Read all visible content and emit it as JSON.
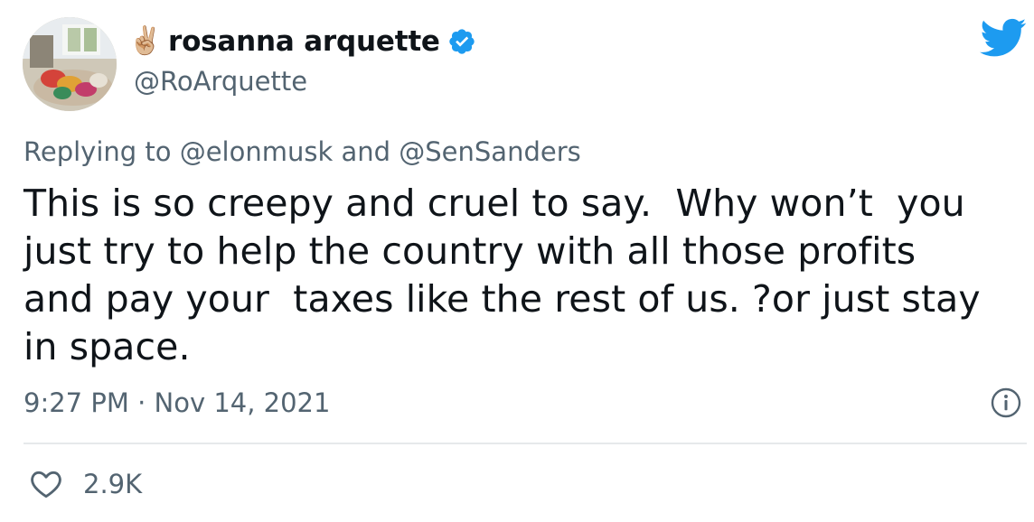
{
  "author": {
    "emoji": "✌🏼",
    "display_name": "rosanna arquette",
    "handle": "@RoArquette",
    "verified": true
  },
  "icons": {
    "avatar": "profile-photo",
    "verified": "verified-badge-icon",
    "brand": "twitter-bird-icon",
    "info": "info-icon",
    "like": "heart-icon"
  },
  "colors": {
    "brand_blue": "#1d9bf0",
    "secondary_text": "#536471",
    "primary_text": "#0f1419",
    "divider": "#e6e9eb"
  },
  "reply": {
    "text": "Replying to @elonmusk and @SenSanders"
  },
  "tweet": {
    "lines": [
      "This is so creepy and cruel to say.  Why won’t  you",
      "just try to help the country with all those profits",
      "and pay your  taxes like the rest of us. ?or just stay",
      "in space."
    ],
    "timestamp": "9:27 PM · Nov 14, 2021"
  },
  "engagement": {
    "likes": "2.9K"
  }
}
